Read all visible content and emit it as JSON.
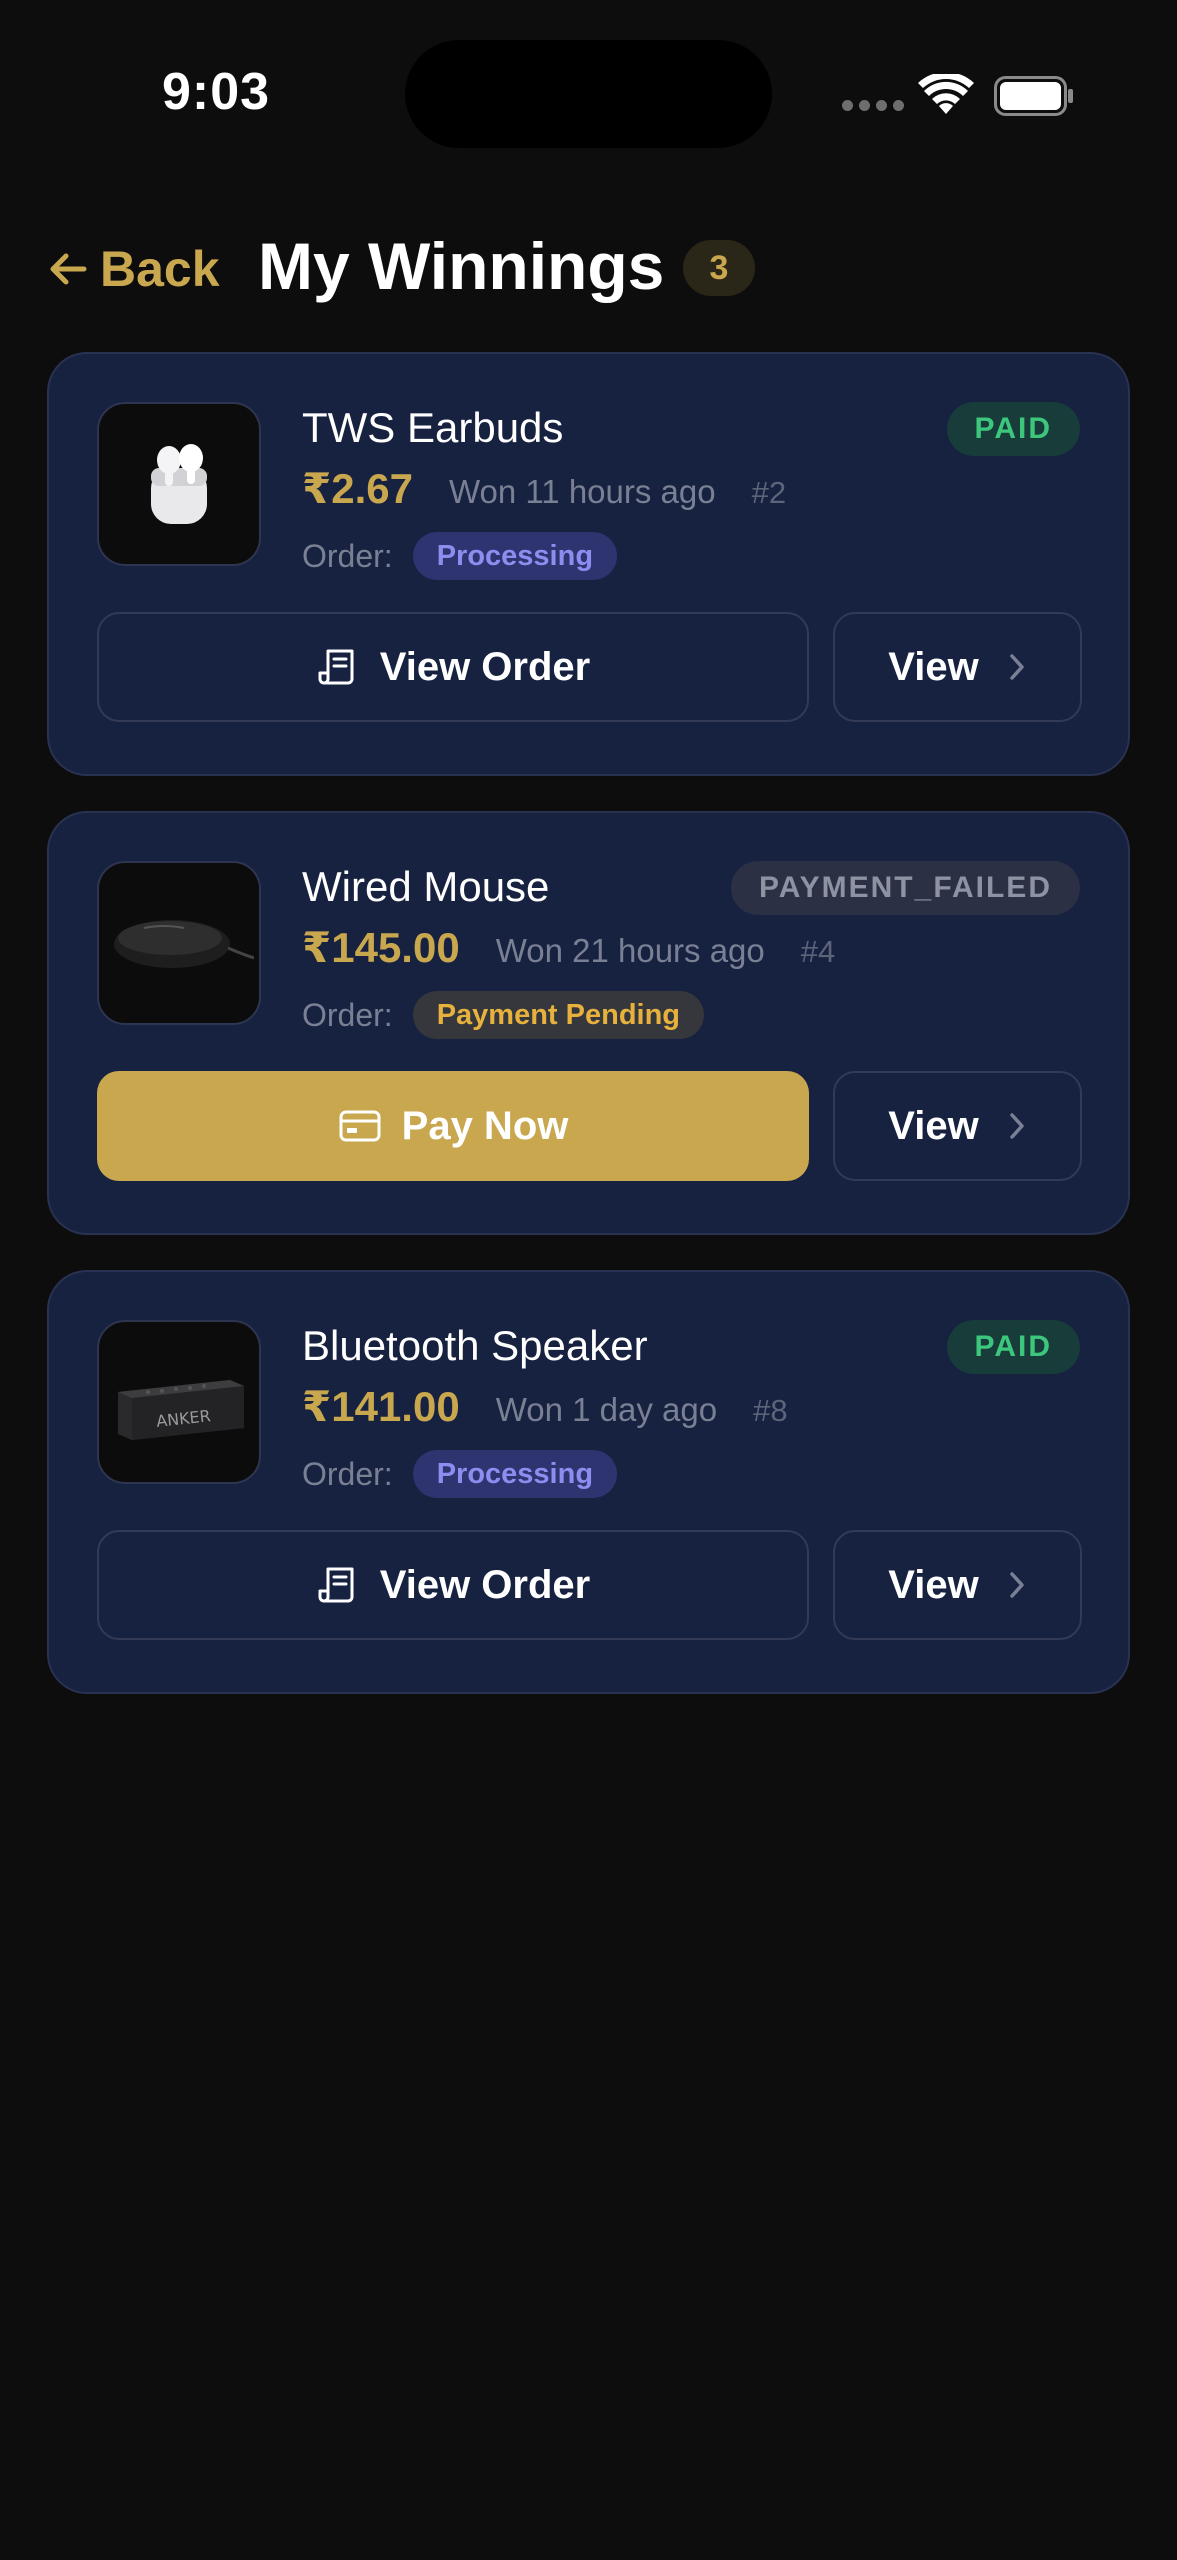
{
  "status_bar": {
    "time": "9:03"
  },
  "header": {
    "back_label": "Back",
    "title": "My Winnings",
    "count": "3"
  },
  "colors": {
    "accent": "#c9a74f",
    "card": "#172140",
    "paid": "#3cc77c",
    "processing": "#8f8cf0",
    "pending": "#e6b13c"
  },
  "cards": [
    {
      "name": "TWS Earbuds",
      "status": "PAID",
      "price": "₹2.67",
      "won": "Won 11 hours ago",
      "ref": "#2",
      "order_label": "Order:",
      "order_status": "Processing",
      "primary_label": "View Order",
      "primary_icon": "receipt-icon",
      "view_label": "View"
    },
    {
      "name": "Wired Mouse",
      "status": "PAYMENT_FAILED",
      "price": "₹145.00",
      "won": "Won 21 hours ago",
      "ref": "#4",
      "order_label": "Order:",
      "order_status": "Payment Pending",
      "primary_label": "Pay Now",
      "primary_icon": "credit-card-icon",
      "view_label": "View"
    },
    {
      "name": "Bluetooth Speaker",
      "status": "PAID",
      "price": "₹141.00",
      "won": "Won 1 day ago",
      "ref": "#8",
      "order_label": "Order:",
      "order_status": "Processing",
      "primary_label": "View Order",
      "primary_icon": "receipt-icon",
      "view_label": "View",
      "brand_text": "ANKER"
    }
  ]
}
